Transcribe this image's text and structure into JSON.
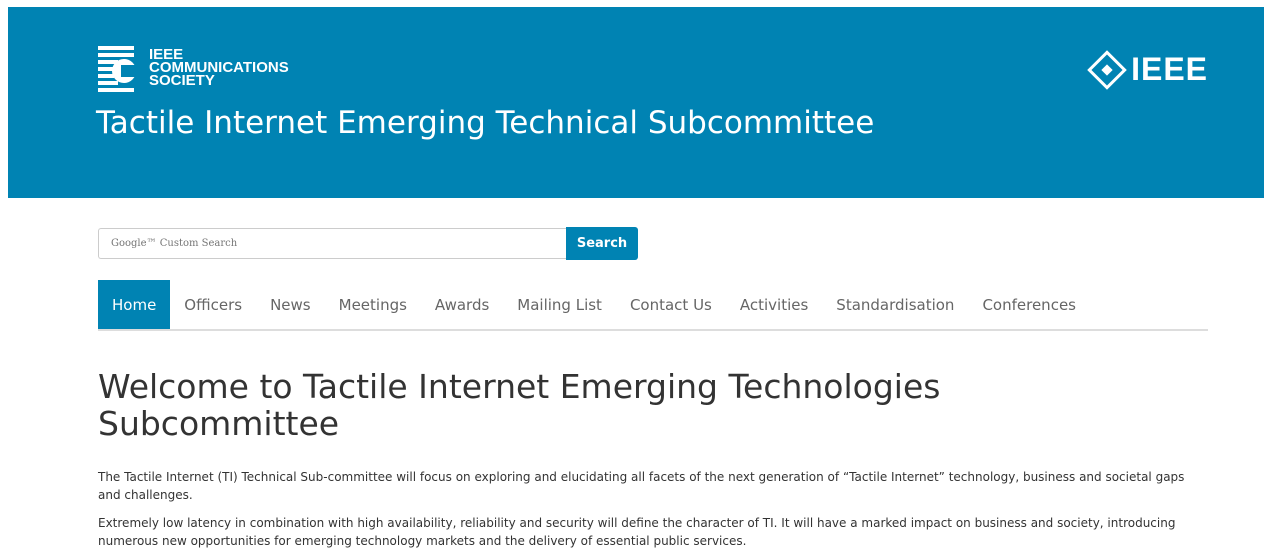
{
  "header": {
    "comsoc_logo_lines": [
      "IEEE",
      "COMMUNICATIONS",
      "SOCIETY"
    ],
    "ieee_logo_text": "IEEE",
    "site_title": "Tactile Internet Emerging Technical Subcommittee",
    "background_color": "#0083b3"
  },
  "search": {
    "placeholder": "Google™ Custom Search",
    "button_label": "Search"
  },
  "nav": {
    "items": [
      {
        "label": "Home",
        "active": true
      },
      {
        "label": "Officers"
      },
      {
        "label": "News"
      },
      {
        "label": "Meetings"
      },
      {
        "label": "Awards"
      },
      {
        "label": "Mailing List"
      },
      {
        "label": "Contact Us"
      },
      {
        "label": "Activities"
      },
      {
        "label": "Standardisation"
      },
      {
        "label": "Conferences"
      }
    ]
  },
  "main": {
    "heading": "Welcome to Tactile Internet Emerging Technologies Subcommittee",
    "paragraphs": [
      "The Tactile Internet (TI) Technical Sub-committee will focus on exploring and elucidating all facets of the next generation of “Tactile Internet” technology, business and societal gaps and challenges.",
      "Extremely low latency in combination with high availability, reliability and security will define the character of TI. It will have a marked impact on business and society, introducing numerous new opportunities for emerging technology markets and the delivery of essential public services."
    ]
  }
}
